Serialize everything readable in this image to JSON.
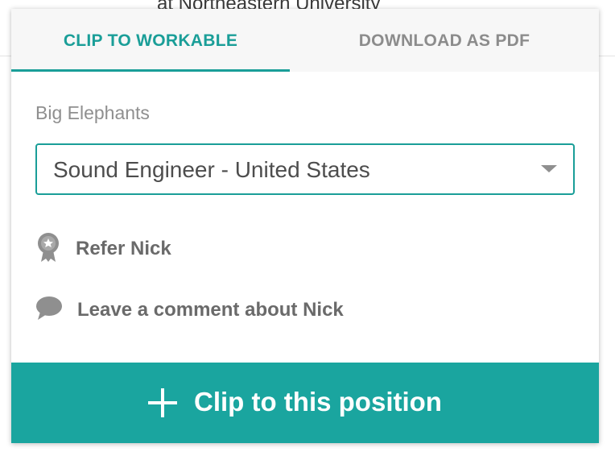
{
  "background": {
    "text": "at Northeastern University"
  },
  "tabs": [
    {
      "label": "CLIP TO WORKABLE",
      "active": true
    },
    {
      "label": "DOWNLOAD AS PDF",
      "active": false
    }
  ],
  "company": "Big Elephants",
  "position_select": {
    "value": "Sound Engineer - United States"
  },
  "actions": {
    "refer": {
      "label": "Refer Nick",
      "icon": "award-ribbon-icon"
    },
    "comment": {
      "label": "Leave a comment about Nick",
      "icon": "speech-bubble-icon"
    }
  },
  "clip_button": {
    "label": "Clip to this position",
    "icon": "plus-icon"
  },
  "colors": {
    "accent": "#1aa59f",
    "tab_active": "#1a9e98",
    "text_muted": "#8f8f8f",
    "text_dark": "#6a6a6a"
  }
}
